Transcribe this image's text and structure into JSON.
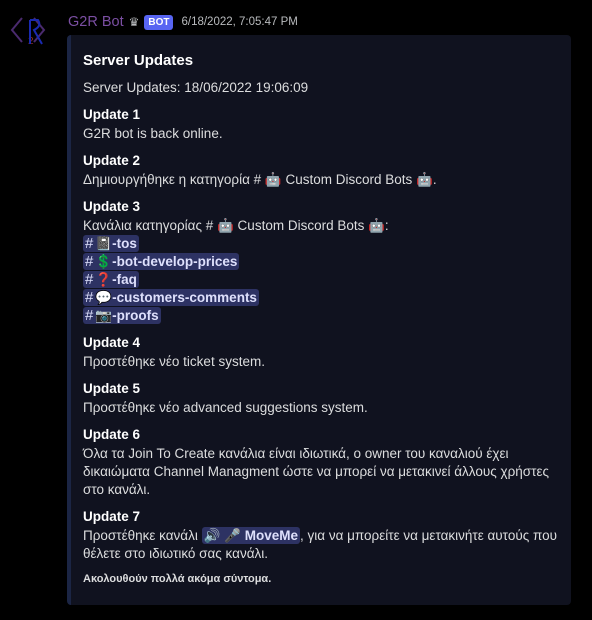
{
  "message": {
    "username": "G2R Bot",
    "bot_badge": "BOT",
    "timestamp": "6/18/2022, 7:05:47 PM",
    "username_color": "#7b4fa3",
    "icons": {
      "crown": "crown-icon",
      "avatar": "g2r-logo"
    }
  },
  "embed": {
    "title": "Server Updates",
    "description": "Server Updates: 18/06/2022 19:06:09",
    "fields": [
      {
        "name": "Update 1",
        "value": "G2R bot is back online."
      },
      {
        "name": "Update 2",
        "value_prefix": "Δημιουργήθηκε η κατηγορία # ",
        "category": "🤖 Custom Discord Bots 🤖",
        "value_suffix": "."
      },
      {
        "name": "Update 3",
        "value_prefix": "Κανάλια κατηγορίας # ",
        "category": "🤖 Custom Discord Bots 🤖",
        "value_suffix": ":",
        "channels": [
          {
            "emoji": "📓",
            "name": "-tos"
          },
          {
            "emoji": "💲",
            "name": "-bot-develop-prices"
          },
          {
            "emoji": "❓",
            "name": "-faq"
          },
          {
            "emoji": "💬",
            "name": "-customers-comments"
          },
          {
            "emoji": "📷",
            "name": "-proofs"
          }
        ]
      },
      {
        "name": "Update 4",
        "value": "Προστέθηκε νέο ticket system."
      },
      {
        "name": "Update 5",
        "value": "Προστέθηκε νέο advanced suggestions system."
      },
      {
        "name": "Update 6",
        "value": "Όλα τα Join To Create κανάλια είναι ιδιωτικά, ο owner του καναλιού έχει δικαιώματα Channel Managment ώστε να μπορεί να μετακινεί άλλους χρήστες στο κανάλι."
      },
      {
        "name": "Update 7",
        "value_prefix": "Προστέθηκε κανάλι ",
        "voice_channel": {
          "icon": "🔊",
          "name": "🎤 MoveMe"
        },
        "value_suffix": ", για να μπορείτε να μετακινήτε αυτούς που θέλετε στο ιδιωτικό σας κανάλι."
      }
    ],
    "footer": "Ακολουθούν πολλά ακόμα σύντομα.",
    "channel_hash": "#"
  }
}
